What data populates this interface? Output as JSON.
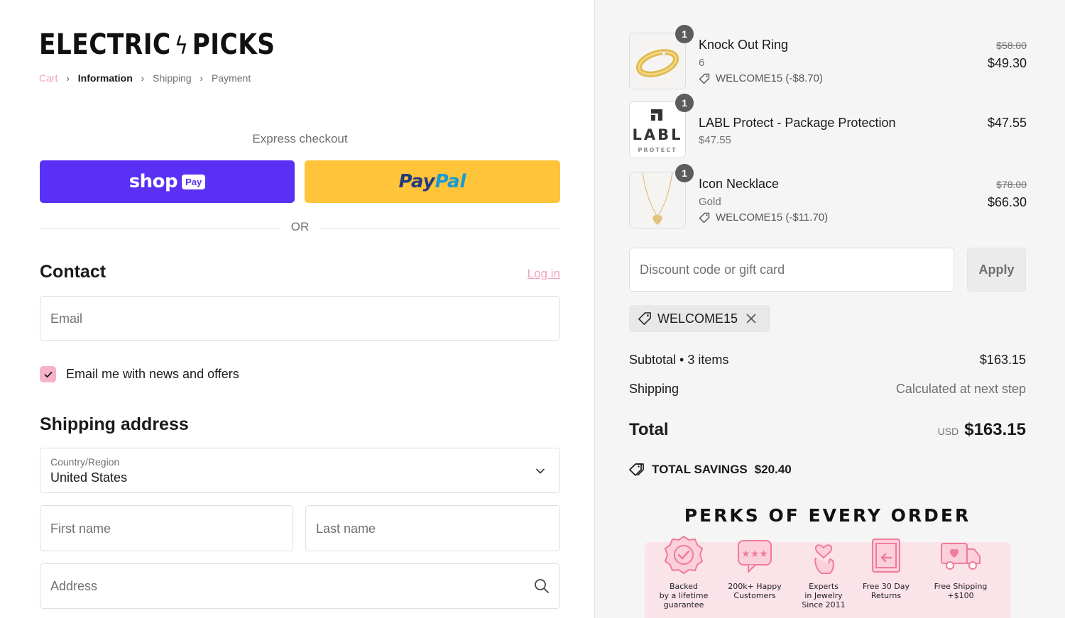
{
  "brand": {
    "name_part1": "ELECTRIC",
    "bolt": "ϟ",
    "name_part2": "PICKS"
  },
  "breadcrumb": {
    "items": [
      "Cart",
      "Information",
      "Shipping",
      "Payment"
    ],
    "separator": "›"
  },
  "express": {
    "label": "Express checkout",
    "shop_label": "shop",
    "shop_pay_badge": "Pay",
    "paypal_part1": "Pay",
    "paypal_part2": "Pal",
    "or_label": "OR"
  },
  "contact": {
    "title": "Contact",
    "login_link": "Log in",
    "email_placeholder": "Email",
    "newsletter_label": "Email me with news and offers",
    "newsletter_checked": true
  },
  "shipping": {
    "title": "Shipping address",
    "country_label": "Country/Region",
    "country_value": "United States",
    "first_name_placeholder": "First name",
    "last_name_placeholder": "Last name",
    "address_placeholder": "Address"
  },
  "cart": {
    "items": [
      {
        "qty": "1",
        "name": "Knock Out Ring",
        "variant": "6",
        "discount": "WELCOME15 (-$8.70)",
        "old_price": "$58.00",
        "price": "$49.30"
      },
      {
        "qty": "1",
        "name": "LABL Protect - Package Protection",
        "variant": "$47.55",
        "price": "$47.55",
        "thumb_text": "LABL",
        "thumb_sub": "PROTECT"
      },
      {
        "qty": "1",
        "name": "Icon Necklace",
        "variant": "Gold",
        "discount": "WELCOME15 (-$11.70)",
        "old_price": "$78.00",
        "price": "$66.30"
      }
    ]
  },
  "discount": {
    "placeholder": "Discount code or gift card",
    "apply_label": "Apply",
    "applied_code": "WELCOME15"
  },
  "summary": {
    "subtotal_label": "Subtotal • 3 items",
    "subtotal_value": "$163.15",
    "shipping_label": "Shipping",
    "shipping_value": "Calculated at next step",
    "total_label": "Total",
    "currency": "USD",
    "total_value": "$163.15",
    "savings_label": "TOTAL SAVINGS",
    "savings_value": "$20.40"
  },
  "perks": {
    "title": "PERKS OF EVERY ORDER",
    "items": [
      {
        "line1": "Backed",
        "line2": "by a lifetime",
        "line3": "guarantee",
        "icon": "badge-icon"
      },
      {
        "line1": "200k+ Happy",
        "line2": "Customers",
        "line3": "",
        "icon": "stars-icon"
      },
      {
        "line1": "Experts",
        "line2": "in Jewelry",
        "line3": "Since 2011",
        "icon": "hand-heart-icon"
      },
      {
        "line1": "Free 30 Day",
        "line2": "Returns",
        "line3": "",
        "icon": "returns-icon"
      },
      {
        "line1": "Free Shipping",
        "line2": "+$100",
        "line3": "",
        "icon": "truck-icon"
      }
    ]
  },
  "colors": {
    "accent_pink": "#f2a3b9",
    "shop_purple": "#5a31f4",
    "paypal_yellow": "#ffc439",
    "perk_pink": "#f07c99"
  }
}
